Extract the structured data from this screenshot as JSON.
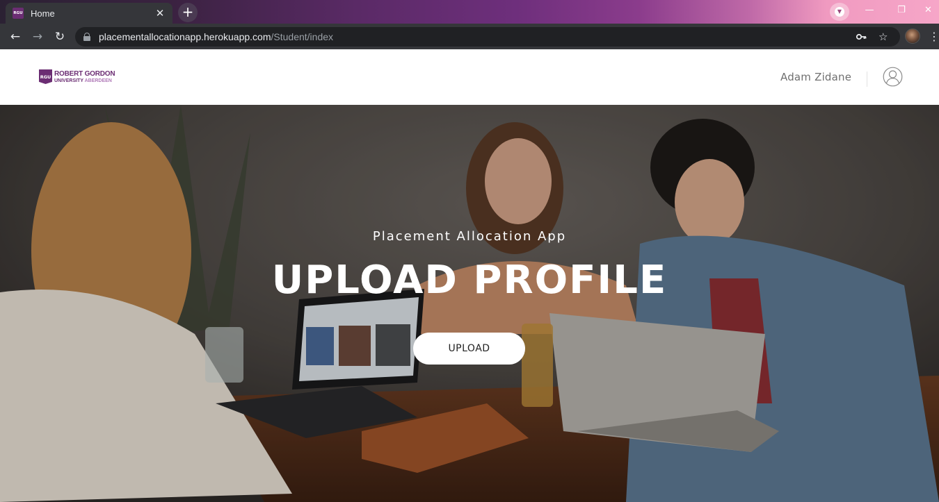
{
  "browser": {
    "tab": {
      "favicon_text": "RGU",
      "title": "Home",
      "close_glyph": "✕"
    },
    "new_tab_glyph": "+",
    "window_controls": {
      "minimize": "—",
      "restore": "❐",
      "close": "✕"
    },
    "nav": {
      "back": "←",
      "forward": "→",
      "reload": "↻"
    },
    "address": {
      "host": "placementallocationapp.herokuapp.com",
      "path": "/Student/index"
    },
    "omnibox_icons": {
      "key": "key-icon",
      "star": "☆"
    },
    "menu_glyph": "⋮"
  },
  "site": {
    "logo": {
      "badge": "RGU",
      "line1": "ROBERT GORDON",
      "line2_a": "UNIVERSITY",
      "line2_b": "ABERDEEN"
    },
    "user": {
      "name": "Adam Zidane"
    }
  },
  "hero": {
    "subtitle": "Placement Allocation App",
    "title": "UPLOAD PROFILE",
    "button_label": "UPLOAD"
  },
  "colors": {
    "brand_purple": "#6b2d73",
    "chrome_dark": "#35363a"
  }
}
